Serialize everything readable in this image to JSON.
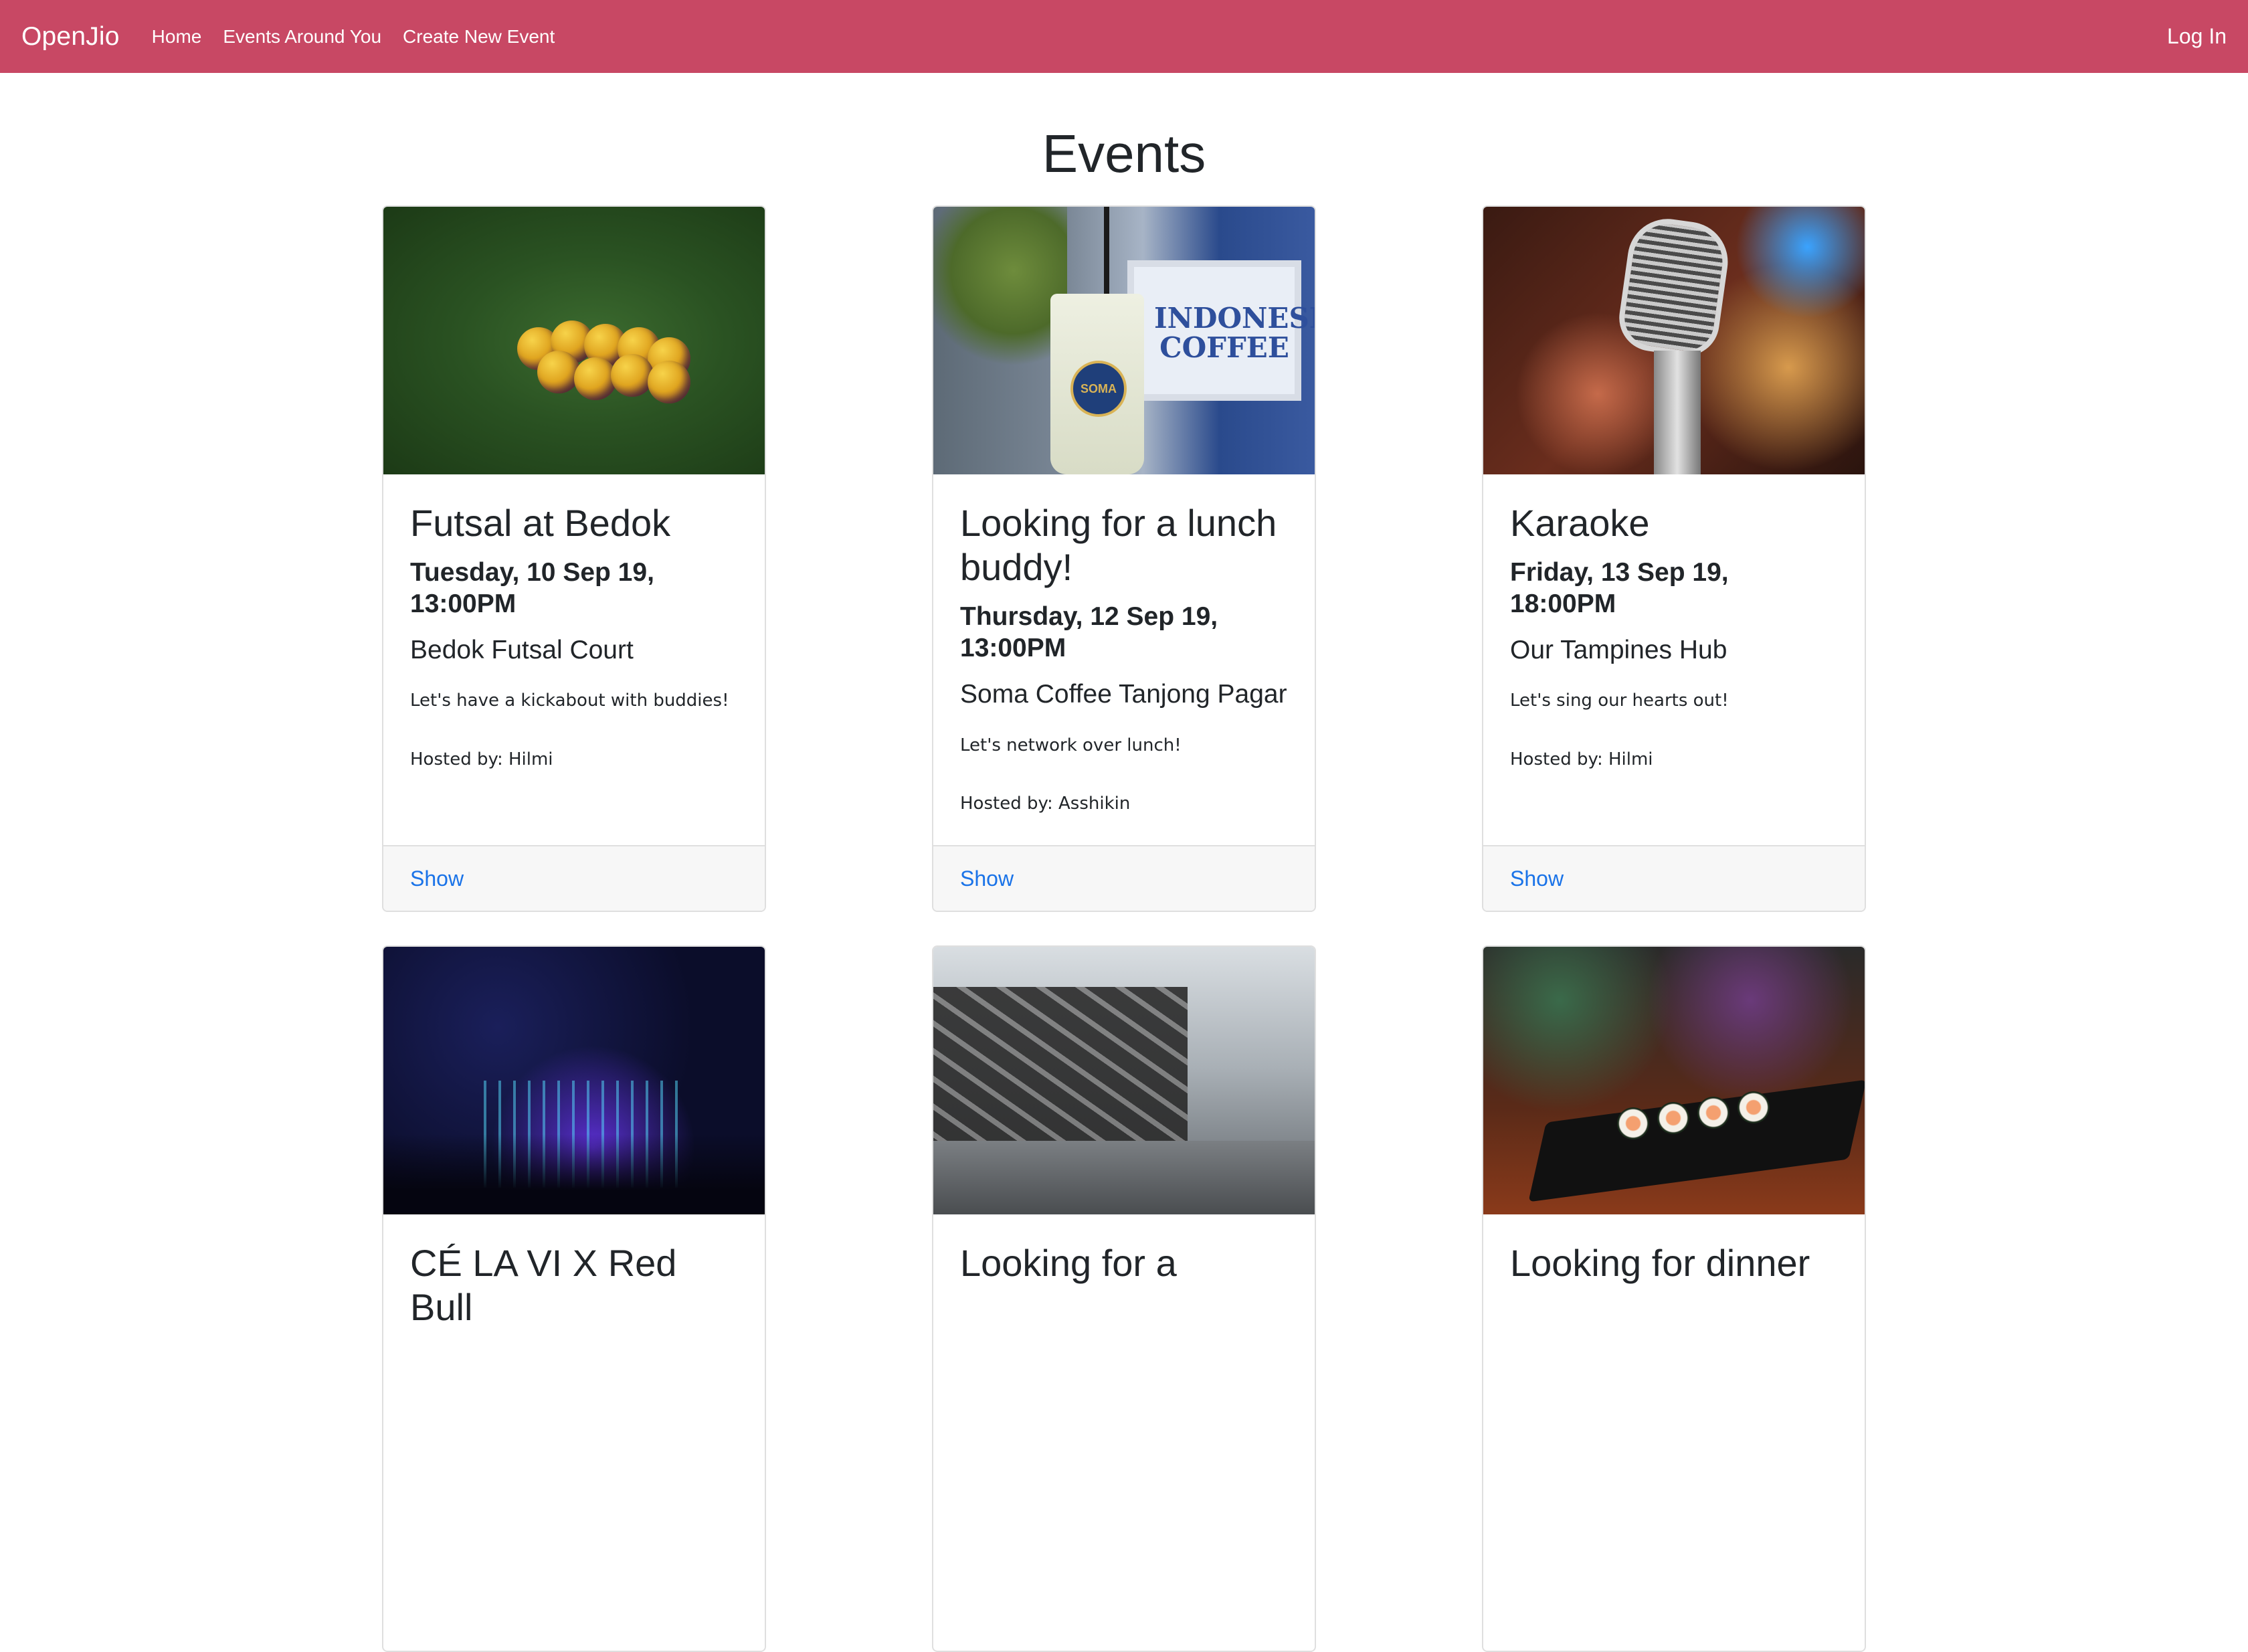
{
  "navbar": {
    "brand": "OpenJio",
    "links": [
      "Home",
      "Events Around You",
      "Create New Event"
    ],
    "login": "Log In",
    "bg_color": "#c84864"
  },
  "page": {
    "title": "Events"
  },
  "events": [
    {
      "title": "Futsal at Bedok",
      "date": "Tuesday, 10 Sep 19, 13:00PM",
      "venue": "Bedok Futsal Court",
      "description": "Let's have a kickabout with buddies!",
      "host": "Hosted by: Hilmi",
      "action": "Show",
      "image": "soccer-balls-on-grass"
    },
    {
      "title": "Looking for a lunch buddy!",
      "date": "Thursday, 12 Sep 19, 13:00PM",
      "venue": "Soma Coffee Tanjong Pagar",
      "description": "Let's network over lunch!",
      "host": "Hosted by: Asshikin",
      "action": "Show",
      "image": "iced-coffee-cup",
      "image_text": {
        "sign": "INDONESIAN COFFEE",
        "cup": "SOMA"
      }
    },
    {
      "title": "Karaoke",
      "date": "Friday, 13 Sep 19, 18:00PM",
      "venue": "Our Tampines Hub",
      "description": "Let's sing our hearts out!",
      "host": "Hosted by: Hilmi",
      "action": "Show",
      "image": "vintage-microphone"
    },
    {
      "title": "CÉ LA VI X Red Bull",
      "image": "nightclub-crowd"
    },
    {
      "title": "Looking for a",
      "image": "gym-dumbbell-rack"
    },
    {
      "title": "Looking for dinner",
      "image": "sushi-platter"
    }
  ],
  "colors": {
    "link": "#1a73e8",
    "card_border": "#dfdfdf",
    "card_footer_bg": "#f7f7f7"
  }
}
